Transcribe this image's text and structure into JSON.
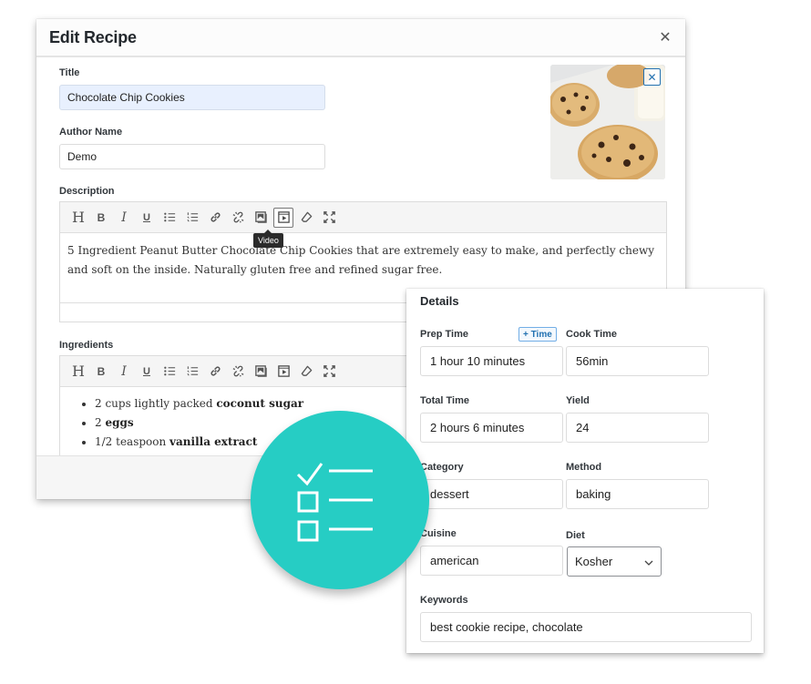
{
  "modal": {
    "title": "Edit Recipe",
    "close_icon": "close-icon",
    "fields": {
      "title_label": "Title",
      "title_value": "Chocolate Chip Cookies",
      "author_label": "Author Name",
      "author_value": "Demo",
      "description_label": "Description",
      "ingredients_label": "Ingredients"
    },
    "image": {
      "alt": "Chocolate chip cookies with glass of milk",
      "remove_icon": "close-icon"
    },
    "toolbar_buttons": [
      {
        "name": "heading",
        "icon": "heading-icon",
        "glyph": "H"
      },
      {
        "name": "bold",
        "icon": "bold-icon",
        "glyph": "B"
      },
      {
        "name": "italic",
        "icon": "italic-icon",
        "glyph": "I"
      },
      {
        "name": "underline",
        "icon": "underline-icon",
        "glyph": "U"
      },
      {
        "name": "bullet-list",
        "icon": "bullet-list-icon"
      },
      {
        "name": "numbered-list",
        "icon": "numbered-list-icon"
      },
      {
        "name": "link",
        "icon": "link-icon"
      },
      {
        "name": "unlink",
        "icon": "unlink-icon"
      },
      {
        "name": "image",
        "icon": "image-icon"
      },
      {
        "name": "video",
        "icon": "video-icon"
      },
      {
        "name": "clear-format",
        "icon": "eraser-icon"
      },
      {
        "name": "fullscreen",
        "icon": "fullscreen-icon"
      }
    ],
    "tooltip": "Video",
    "description_text": "5 Ingredient Peanut Butter Chocolate Chip Cookies that are extremely easy to make, and perfectly chewy and soft on the inside. Naturally gluten free and refined sugar free.",
    "ingredients": [
      {
        "plain": "2 cups lightly packed ",
        "bold": "coconut sugar"
      },
      {
        "plain": "2 ",
        "bold": "eggs"
      },
      {
        "plain": "1/2 teaspoon ",
        "bold": "vanilla extract"
      }
    ]
  },
  "details": {
    "title": "Details",
    "add_time_label": "+ Time",
    "prep_time": {
      "label": "Prep Time",
      "value": "1 hour 10 minutes"
    },
    "cook_time": {
      "label": "Cook Time",
      "value": "56min"
    },
    "total_time": {
      "label": "Total Time",
      "value": "2 hours 6 minutes"
    },
    "yield": {
      "label": "Yield",
      "value": "24"
    },
    "category": {
      "label": "Category",
      "value": "dessert"
    },
    "method": {
      "label": "Method",
      "value": "baking"
    },
    "cuisine": {
      "label": "Cuisine",
      "value": "american"
    },
    "diet": {
      "label": "Diet",
      "value": "Kosher"
    },
    "keywords": {
      "label": "Keywords",
      "value": "best cookie recipe, chocolate"
    }
  },
  "badge": {
    "icon": "checklist-icon",
    "color": "#26cdc4"
  },
  "colors": {
    "accent": "#2271b1",
    "teal": "#26cdc4",
    "autofill": "#e8f0fe"
  }
}
